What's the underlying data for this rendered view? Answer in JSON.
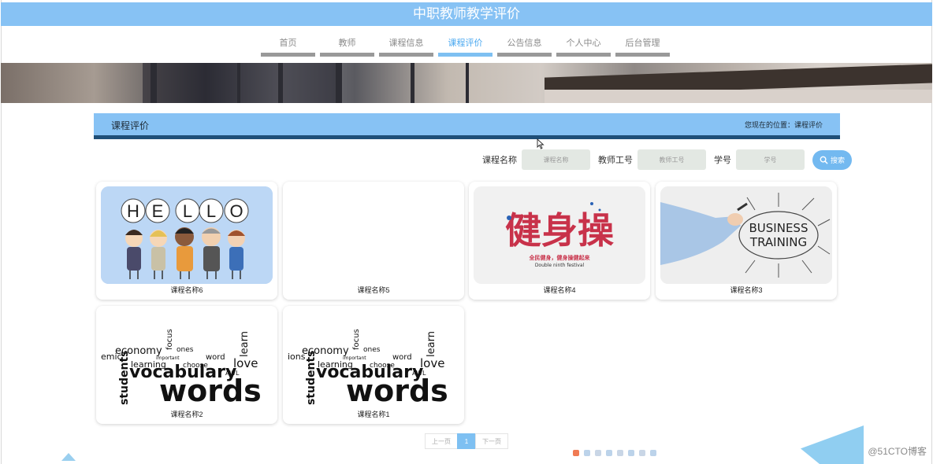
{
  "app": {
    "title": "中职教师教学评价"
  },
  "nav": {
    "items": [
      {
        "label": "首页"
      },
      {
        "label": "教师"
      },
      {
        "label": "课程信息"
      },
      {
        "label": "课程评价",
        "active": true
      },
      {
        "label": "公告信息"
      },
      {
        "label": "个人中心"
      },
      {
        "label": "后台管理"
      }
    ]
  },
  "section": {
    "title": "课程评价",
    "breadcrumb": "您现在的位置：课程评价"
  },
  "search": {
    "course_label": "课程名称",
    "course_placeholder": "课程名称",
    "teacher_label": "教师工号",
    "teacher_placeholder": "教师工号",
    "student_label": "学号",
    "student_placeholder": "学号",
    "button_label": "搜索"
  },
  "cards": [
    {
      "name": "课程名称6",
      "image": "hello-kids-illustration",
      "hello_letters": [
        "H",
        "E",
        "L",
        "L",
        "O"
      ]
    },
    {
      "name": "课程名称5",
      "image": "blank"
    },
    {
      "name": "课程名称4",
      "image": "jianshencao-calligraphy",
      "calligraphy": "健身操",
      "caption_cn": "全民健身，健身操健起来",
      "caption_en": "Double ninth festival"
    },
    {
      "name": "课程名称3",
      "image": "business-training",
      "line1": "BUSINESS",
      "line2": "TRAINING"
    },
    {
      "name": "课程名称2",
      "image": "vocabulary-word-cloud",
      "words": [
        "words",
        "vocabulary",
        "economy",
        "learning",
        "love",
        "learn",
        "students",
        "word",
        "choose",
        "focus",
        "emic",
        "important",
        "ones",
        "AWL"
      ]
    },
    {
      "name": "课程名称1",
      "image": "vocabulary-word-cloud",
      "words": [
        "words",
        "vocabulary",
        "economy",
        "learning",
        "love",
        "learn",
        "students",
        "word",
        "choose",
        "focus",
        "ions",
        "important",
        "ones",
        "AWL"
      ]
    }
  ],
  "pagination": {
    "prev": "上一页",
    "current": "1",
    "next": "下一页"
  },
  "watermark": "@51CTO博客",
  "colors": {
    "accent": "#87c2f4",
    "dark_bar": "#1f4f78",
    "button": "#73b9f0"
  }
}
